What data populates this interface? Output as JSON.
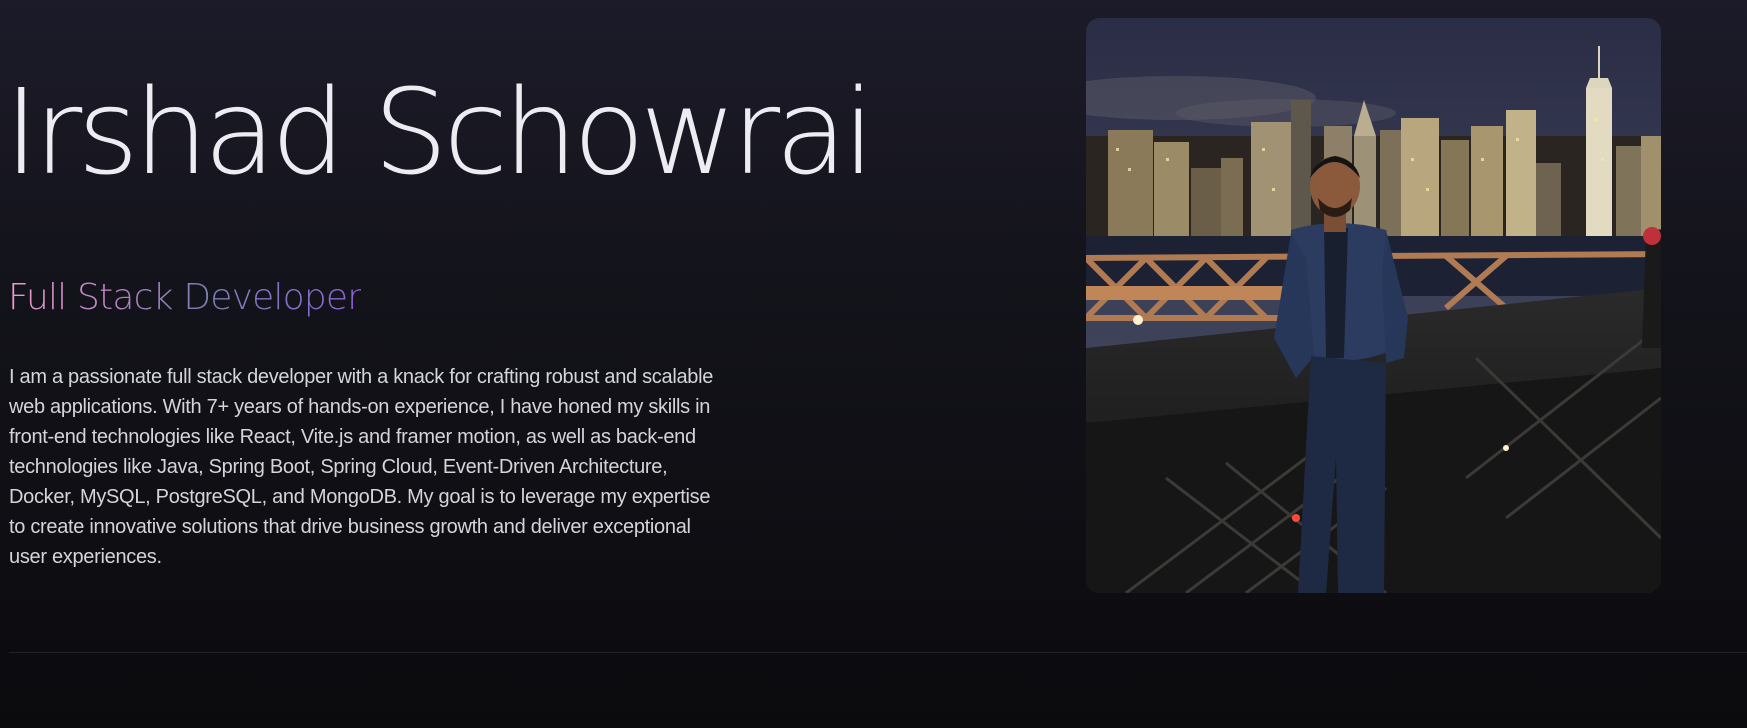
{
  "hero": {
    "name": "Irshad Schowrai",
    "role": "Full Stack Developer",
    "bio": "I am a passionate full stack developer with a knack for crafting robust and scalable web applications. With 7+ years of hands-on experience, I have honed my skills in front-end technologies like React, Vite.js and framer motion, as well as back-end technologies like Java, Spring Boot, Spring Cloud, Event-Driven Architecture, Docker, MySQL, PostgreSQL, and MongoDB. My goal is to leverage my expertise to create innovative solutions that drive business growth and deliver exceptional user experiences."
  },
  "colors": {
    "background_top": "#1c1b29",
    "background_bottom": "#0b0b0e",
    "name_text": "#ececf2",
    "role_gradient_start": "#ee9bcf",
    "role_gradient_end": "#9062d9",
    "bio_text": "#d4d4da"
  }
}
